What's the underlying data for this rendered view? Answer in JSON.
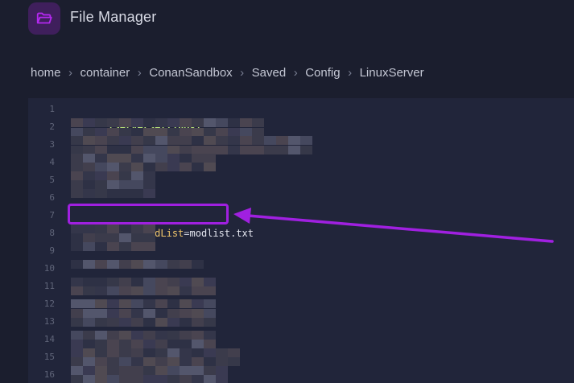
{
  "app": {
    "title": "File Manager",
    "icon": "folder-open-icon",
    "accent_color": "#a020e0",
    "icon_bg": "#3f1f5c"
  },
  "breadcrumb": [
    "home",
    "container",
    "ConanSandbox",
    "Saved",
    "Config",
    "LinuxServer"
  ],
  "editor": {
    "line_numbers": [
      "1",
      "2",
      "3",
      "4",
      "5",
      "6",
      "7",
      "8",
      "9",
      "10",
      "11",
      "12",
      "13",
      "14",
      "15",
      "16"
    ],
    "line1": "[ServerSettings]",
    "line7": {
      "key": "ServerModList",
      "eq": "=",
      "value": "modlist.txt"
    },
    "blurred_lines": "lines 2-6 and 8-16 are pixelated/obscured"
  }
}
